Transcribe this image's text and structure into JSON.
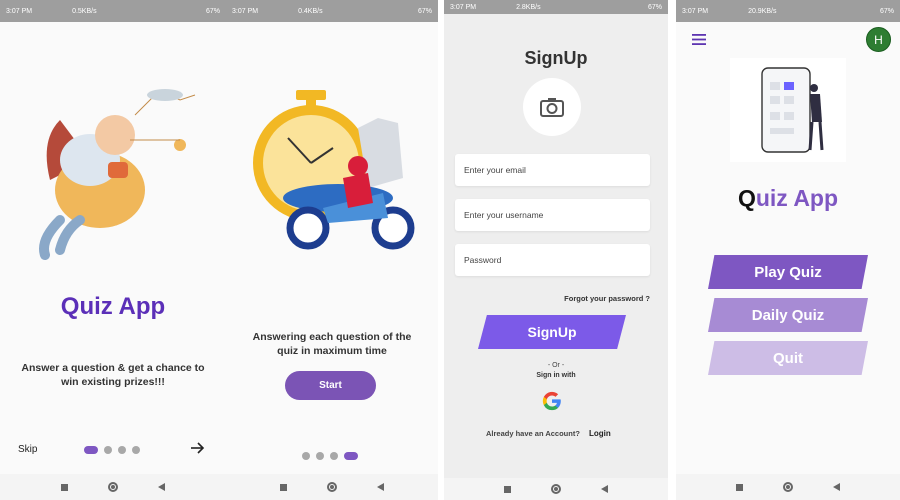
{
  "status": {
    "time": "3:07 PM",
    "panels": [
      {
        "speed": "0.5KB/s",
        "battery": "67%"
      },
      {
        "speed": "0.4KB/s",
        "battery": "67%"
      },
      {
        "speed": "2.8KB/s",
        "battery": "67%"
      },
      {
        "speed": "20.9KB/s",
        "battery": "67%"
      }
    ]
  },
  "onboarding1": {
    "title": "Quiz App",
    "subtitle": "Answer a question & get a chance to win existing prizes!!!",
    "skip_label": "Skip",
    "active_dot": 1
  },
  "onboarding2": {
    "subtitle": "Answering each question of the quiz in maximum time",
    "start_label": "Start",
    "active_dot": 4
  },
  "signup": {
    "title": "SignUp",
    "email_placeholder": "Enter your email",
    "username_placeholder": "Enter your username",
    "password_placeholder": "Password",
    "forgot_label": "Forgot your password ?",
    "signup_label": "SignUp",
    "or_label": "- Or -",
    "signin_with_label": "Sign in with",
    "have_account_label": "Already have an Account?",
    "login_label": "Login"
  },
  "home": {
    "title_first": "Q",
    "title_rest": "uiz App",
    "avatar_initial": "H",
    "buttons": [
      {
        "label": "Play Quiz"
      },
      {
        "label": "Daily Quiz"
      },
      {
        "label": "Quit"
      }
    ]
  },
  "colors": {
    "brand_purple": "#5b2fb8",
    "button_purple": "#7b54b5",
    "signup_button": "#7c5ae8",
    "play_button": "#7e57c2",
    "daily_button": "#a78bd4",
    "quit_button": "#cdbde6",
    "avatar_green": "#2e7d32"
  }
}
